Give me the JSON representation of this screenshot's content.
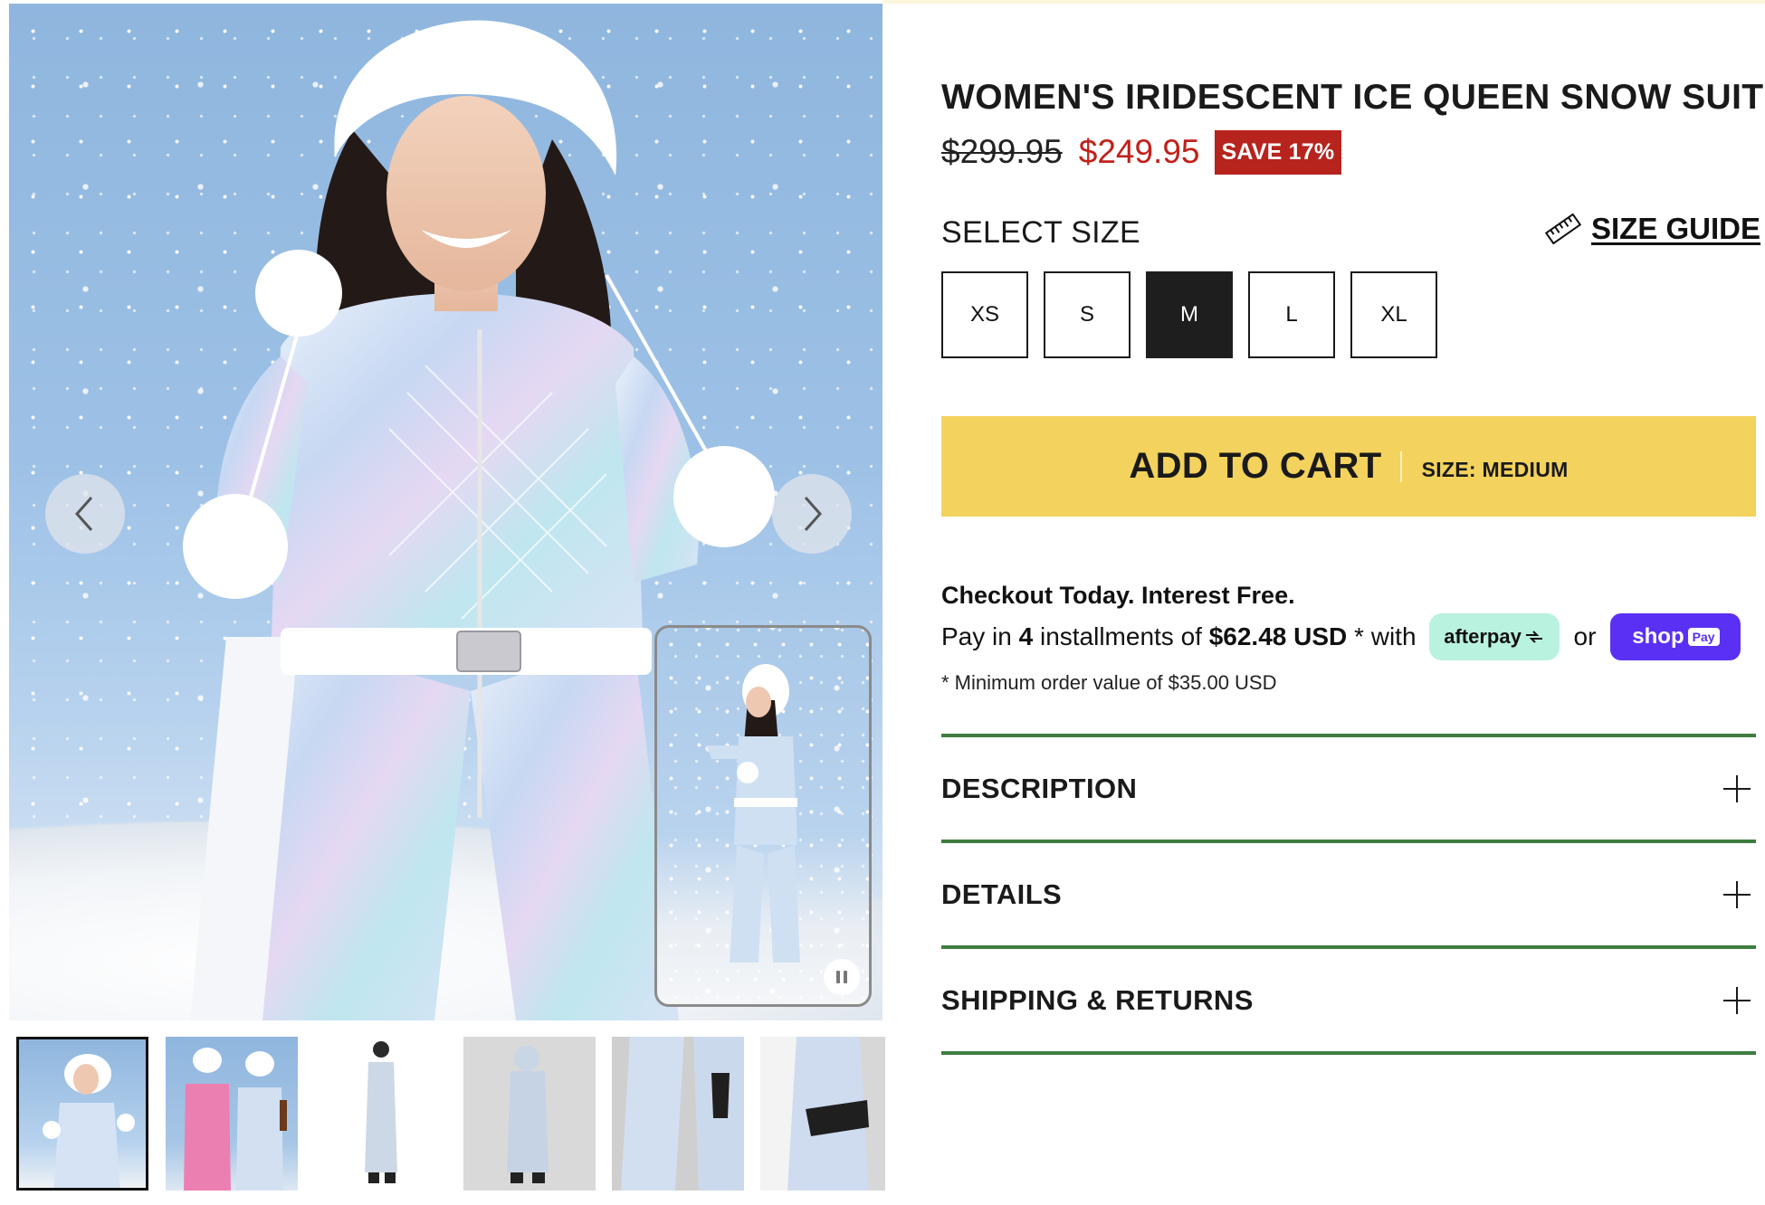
{
  "product": {
    "title": "WOMEN'S IRIDESCENT ICE QUEEN SNOW SUIT",
    "price_original": "$299.95",
    "price_sale": "$249.95",
    "save_badge": "SAVE 17%"
  },
  "size_selector": {
    "label": "SELECT SIZE",
    "size_guide_label": "SIZE GUIDE",
    "options": [
      "XS",
      "S",
      "M",
      "L",
      "XL"
    ],
    "selected": "M"
  },
  "cart": {
    "button_label": "ADD TO CART",
    "size_note": "SIZE: MEDIUM"
  },
  "payment": {
    "headline": "Checkout Today. Interest Free.",
    "line_prefix": "Pay in",
    "installments": "4",
    "line_middle": "installments of",
    "amount": "$62.48 USD",
    "line_suffix": "* with",
    "afterpay_label": "afterpay",
    "or_text": "or",
    "shoppay_label": "shop",
    "shoppay_pill": "Pay",
    "min_order": "* Minimum order value of $35.00 USD"
  },
  "accordion": [
    {
      "label": "DESCRIPTION"
    },
    {
      "label": "DETAILS"
    },
    {
      "label": "SHIPPING & RETURNS"
    }
  ],
  "gallery": {
    "active_index": 0,
    "thumbnail_count": 6
  },
  "colors": {
    "sale_red": "#c0211b",
    "badge_red": "#b7231d",
    "cart_yellow": "#f3d25d",
    "accordion_rule_green": "#3e7d3f",
    "afterpay_mint": "#b9f2df",
    "shoppay_purple": "#5a31f4"
  },
  "icons": {
    "prev": "chevron-left-icon",
    "next": "chevron-right-icon",
    "size_guide": "ruler-icon",
    "video": "pause-icon",
    "accordion": "plus-icon"
  }
}
